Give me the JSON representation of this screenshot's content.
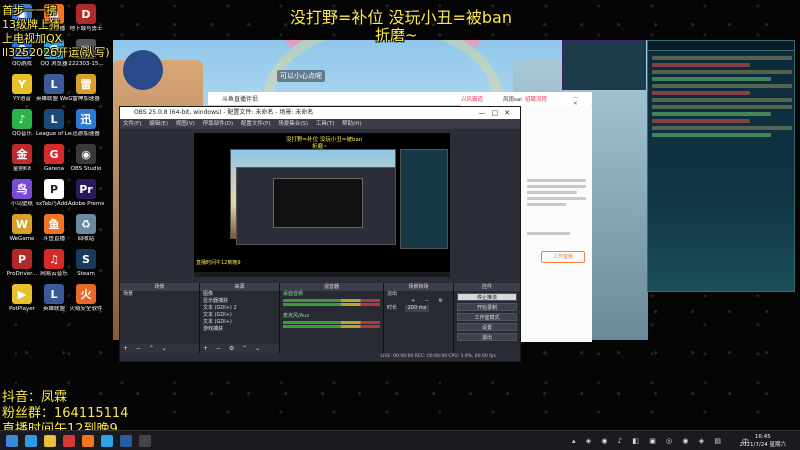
{
  "overlay": {
    "title": "没打野=补位 没玩小丑=被ban",
    "subtitle": "折磨~",
    "top_left": [
      "首步一一拂",
      "13级牌上猜",
      "上电视加QX",
      "ll3252026开运(认写)"
    ],
    "bottom_left": [
      "抖音：凤霖",
      "粉丝群：164115114",
      "直播时间午12到晚9"
    ]
  },
  "desktop_icons": [
    {
      "label": "此电脑",
      "color": "#3a7bd5",
      "glyph": "▣"
    },
    {
      "label": "斗鱼直播",
      "color": "#f27321",
      "glyph": "鱼"
    },
    {
      "label": "地下城与勇士",
      "color": "#b02a2a",
      "glyph": "D"
    },
    {
      "label": "QQ游戏",
      "color": "#2a6fd5",
      "glyph": "Q"
    },
    {
      "label": "QQ 浏览器",
      "color": "#2ba3e8",
      "glyph": "Q"
    },
    {
      "label": "222303-15...",
      "color": "#555",
      "glyph": "▤"
    },
    {
      "label": "YY语音",
      "color": "#e8c02a",
      "glyph": "Y"
    },
    {
      "label": "英雄联盟 WeGame版",
      "color": "#3a5a9a",
      "glyph": "L"
    },
    {
      "label": "雷神加速器",
      "color": "#d8a02a",
      "glyph": "雷"
    },
    {
      "label": "QQ音乐",
      "color": "#29b34a",
      "glyph": "♪"
    },
    {
      "label": "League of Legends",
      "color": "#1a4a7a",
      "glyph": "L"
    },
    {
      "label": "迅游加速器",
      "color": "#2a7ad5",
      "glyph": "迅"
    },
    {
      "label": "金刚Kit",
      "color": "#c02a2a",
      "glyph": "金"
    },
    {
      "label": "Garena",
      "color": "#d52a2a",
      "glyph": "G"
    },
    {
      "label": "OBS Studio",
      "color": "#3a3a3a",
      "glyph": "◉"
    },
    {
      "label": "小鸟壁纸",
      "color": "#7a4ad5",
      "glyph": "鸟"
    },
    {
      "label": "sxTab乃Add...",
      "color": "#fff",
      "glyph": "P"
    },
    {
      "label": "Adobe Premie...",
      "color": "#2a1a5a",
      "glyph": "Pr"
    },
    {
      "label": "WeGame",
      "color": "#d8a02a",
      "glyph": "W"
    },
    {
      "label": "斗鱼直播",
      "color": "#f27321",
      "glyph": "鱼"
    },
    {
      "label": "回收站",
      "color": "#6a8aa0",
      "glyph": "♻"
    },
    {
      "label": "ProDriver...",
      "color": "#b02a2a",
      "glyph": "P"
    },
    {
      "label": "网易云音乐",
      "color": "#d52a2a",
      "glyph": "♫"
    },
    {
      "label": "Steam",
      "color": "#1a3a5a",
      "glyph": "S"
    },
    {
      "label": "PotPlayer",
      "color": "#e8c02a",
      "glyph": "▶"
    },
    {
      "label": "英雄联盟",
      "color": "#3a5a9a",
      "glyph": "L"
    },
    {
      "label": "火绒安全软件",
      "color": "#e86a2a",
      "glyph": "火"
    }
  ],
  "game": {
    "caption": "可以小心点呢"
  },
  "douyu": {
    "title": "斗鱼直播伴侣",
    "link": "风雨",
    "top_right": [
      "兴风霸道",
      "风雨sai",
      "招聘流程"
    ],
    "button": "工作室板"
  },
  "obs": {
    "title": "OBS 25.0.8 (64-bit, windows) - 配置文件: 未命名 - 场景: 未命名",
    "menu": [
      "文件(F)",
      "编辑(E)",
      "视图(V)",
      "停靠部件(D)",
      "配置文件(P)",
      "场景集合(S)",
      "工具(T)",
      "帮助(H)"
    ],
    "preview_title": "没打野=补位 没玩小丑=被ban",
    "preview_sub": "折磨~",
    "preview_footer": "直播时间午12到晚9",
    "docks": {
      "scenes": {
        "header": "场景",
        "items": [
          "场景"
        ]
      },
      "sources": {
        "header": "来源",
        "items": [
          "图像",
          "显示器捕获",
          "文本 (GDI+) 2",
          "文本 (GDI+)",
          "文本 (GDI+)",
          "游戏捕获"
        ]
      },
      "mixer": {
        "header": "混音器",
        "items": [
          "桌面音频",
          "麦克风/Aux"
        ]
      },
      "transitions": {
        "header": "场景转场",
        "type": "淡出",
        "duration_label": "时长",
        "duration": "200 ms"
      },
      "controls": {
        "header": "控件",
        "buttons": [
          "停止推流",
          "开始录制",
          "工作室模式",
          "设置",
          "退出"
        ]
      }
    },
    "status": "LIVE: 00:00:00    REC: 00:00:00    CPU: 1.9%, 60.00 fps"
  },
  "taskbar": {
    "time": "16:45",
    "date": "2021/7/24 星期六",
    "ime": "中",
    "icons": [
      {
        "name": "start-icon",
        "color": "#3a8ad8"
      },
      {
        "name": "browser-icon",
        "color": "#2b9ae8"
      },
      {
        "name": "folder-icon",
        "color": "#e8c040"
      },
      {
        "name": "netease-icon",
        "color": "#d53a3a"
      },
      {
        "name": "douyu-icon",
        "color": "#f27321"
      },
      {
        "name": "qq-browser-icon",
        "color": "#2ba3e8"
      },
      {
        "name": "game-icon",
        "color": "#2a5aa0"
      },
      {
        "name": "obs-taskbar-icon",
        "color": "#444"
      }
    ]
  }
}
